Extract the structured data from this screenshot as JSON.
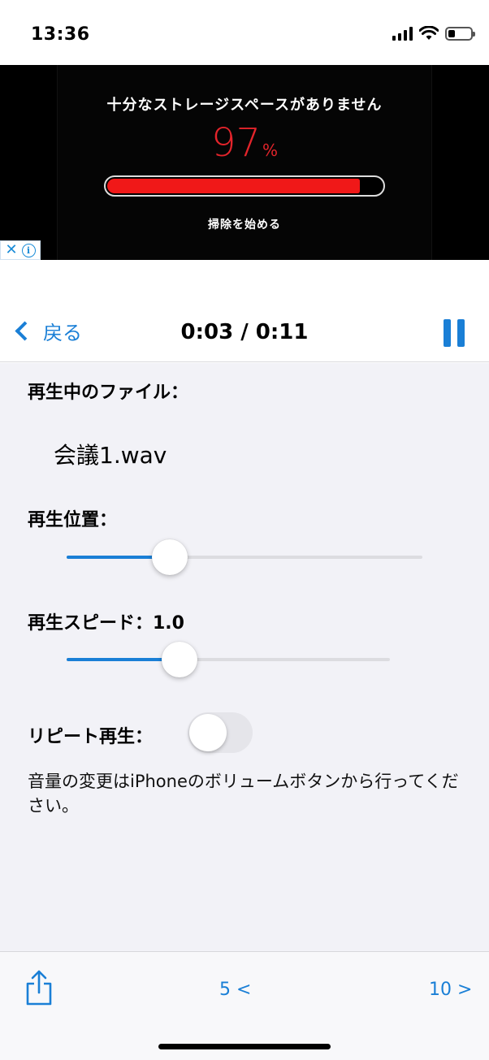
{
  "status_bar": {
    "time": "13:36"
  },
  "ad": {
    "title": "十分なストレージスペースがありません",
    "percent_value": "97",
    "percent_sign": "%",
    "usage_fraction": 0.92,
    "cta": "掃除を始める",
    "badge_close": "✕",
    "badge_info": "i"
  },
  "nav": {
    "back_label": "戻る",
    "title": "0:03 / 0:11"
  },
  "content": {
    "file_label": "再生中のファイル：",
    "file_name": "会議1.wav",
    "position_label": "再生位置：",
    "position_fraction": 0.29,
    "speed_label": "再生スピード：1.0",
    "speed_fraction": 0.35,
    "repeat_label": "リピート再生：",
    "repeat_on": false,
    "note": "音量の変更はiPhoneのボリュームボタンから行ってください。"
  },
  "toolbar": {
    "rewind_label": "5 <",
    "forward_label": "10 >"
  },
  "colors": {
    "accent": "#1a7fd6",
    "ad_red": "#e3242b",
    "background": "#f2f2f7"
  }
}
